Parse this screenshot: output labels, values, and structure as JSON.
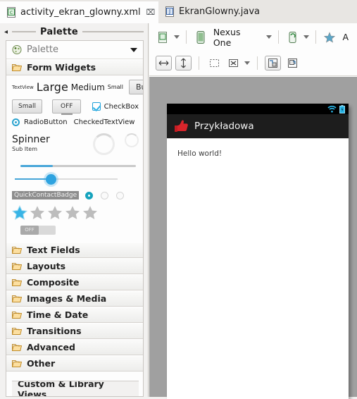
{
  "tabs": [
    {
      "label": "activity_ekran_glowny.xml",
      "icon": "xml-file-icon",
      "active": true,
      "close": "⌧"
    },
    {
      "label": "EkranGlowny.java",
      "icon": "java-file-icon",
      "active": false
    }
  ],
  "palette": {
    "panel_title": "Palette",
    "collapse_icon": "collapse-left-icon",
    "header_label": "Palette",
    "header_icon": "palette-icon",
    "menu_icon": "chevron-down-icon",
    "group_label": "Form Widgets",
    "widgets": {
      "row1": [
        "TextView",
        "Large",
        "Medium",
        "Small",
        "Button"
      ],
      "row2": [
        "Small",
        "OFF",
        "CheckBox"
      ],
      "row3": [
        "RadioButton",
        "CheckedTextView"
      ],
      "spinner": "Spinner",
      "spinner_sub": "Sub Item",
      "quick_contact": "QuickContactBadge",
      "switch_label": "OFF"
    },
    "categories": [
      {
        "label": "Text Fields",
        "icon": "folder-icon"
      },
      {
        "label": "Layouts",
        "icon": "folder-icon"
      },
      {
        "label": "Composite",
        "icon": "folder-icon"
      },
      {
        "label": "Images & Media",
        "icon": "folder-icon"
      },
      {
        "label": "Time & Date",
        "icon": "folder-icon"
      },
      {
        "label": "Transitions",
        "icon": "folder-icon"
      },
      {
        "label": "Advanced",
        "icon": "folder-icon"
      },
      {
        "label": "Other",
        "icon": "folder-icon"
      }
    ],
    "clipped_category": "Custom & Library Views"
  },
  "toolbar": {
    "config_icon": "layout-config-icon",
    "config_caret": "chevron-down-icon",
    "device_icon": "phone-icon",
    "device_name": "Nexus One",
    "device_caret": "chevron-down-icon",
    "orientation_icon": "orientation-portrait-icon",
    "orientation_caret": "chevron-down-icon",
    "theme_icon": "star-icon",
    "theme_label": "A",
    "actions": [
      {
        "icon": "fit-horizontal-icon",
        "pressed": true
      },
      {
        "icon": "fit-vertical-icon",
        "pressed": true
      },
      {
        "icon": "marquee-select-icon",
        "pressed": false
      },
      {
        "icon": "expand-all-icon",
        "pressed": false
      },
      {
        "icon": "chevron-down-icon",
        "pressed": false
      },
      {
        "icon": "outline-nested-icon",
        "pressed": true
      },
      {
        "icon": "include-in-icon",
        "pressed": false
      }
    ]
  },
  "preview": {
    "status_icons": [
      "wifi-icon",
      "battery-icon"
    ],
    "app_icon": "thumbs-up-icon",
    "app_title": "Przykładowa",
    "content_text": "Hello world!"
  },
  "colors": {
    "accent_blue": "#2ea3e0",
    "teal": "#17a3bd",
    "app_icon_red": "#d32026",
    "canvas_gray": "#a0a0a0",
    "appbar_black": "#1d1d1d"
  }
}
